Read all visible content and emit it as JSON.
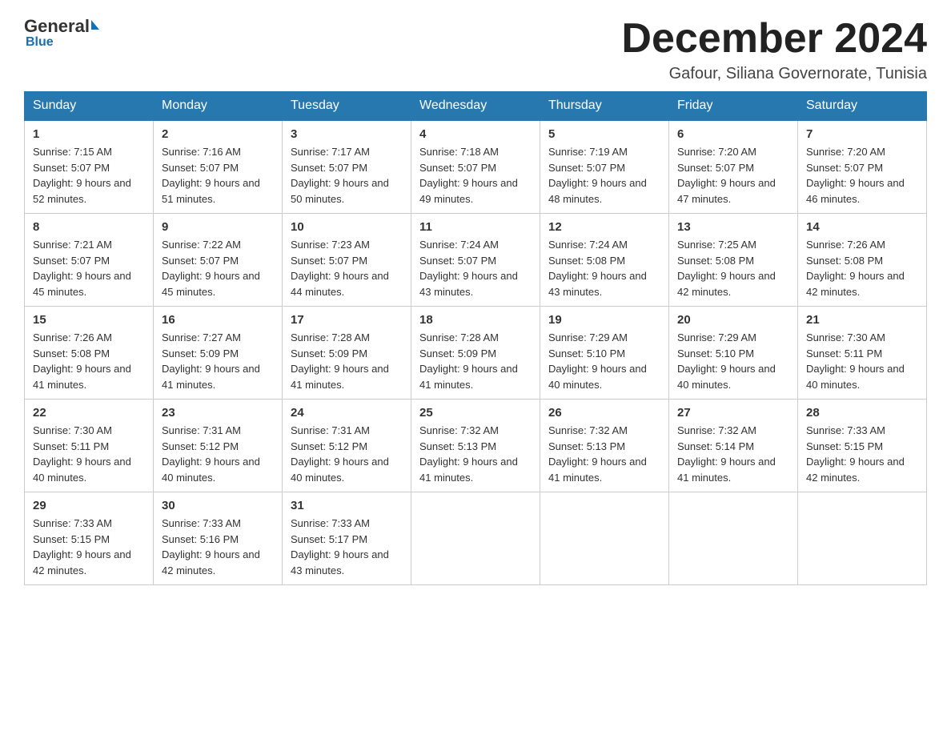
{
  "logo": {
    "general": "General",
    "blue": "Blue",
    "underline": "Blue"
  },
  "header": {
    "month": "December 2024",
    "location": "Gafour, Siliana Governorate, Tunisia"
  },
  "weekdays": [
    "Sunday",
    "Monday",
    "Tuesday",
    "Wednesday",
    "Thursday",
    "Friday",
    "Saturday"
  ],
  "weeks": [
    [
      {
        "day": "1",
        "sunrise": "Sunrise: 7:15 AM",
        "sunset": "Sunset: 5:07 PM",
        "daylight": "Daylight: 9 hours and 52 minutes."
      },
      {
        "day": "2",
        "sunrise": "Sunrise: 7:16 AM",
        "sunset": "Sunset: 5:07 PM",
        "daylight": "Daylight: 9 hours and 51 minutes."
      },
      {
        "day": "3",
        "sunrise": "Sunrise: 7:17 AM",
        "sunset": "Sunset: 5:07 PM",
        "daylight": "Daylight: 9 hours and 50 minutes."
      },
      {
        "day": "4",
        "sunrise": "Sunrise: 7:18 AM",
        "sunset": "Sunset: 5:07 PM",
        "daylight": "Daylight: 9 hours and 49 minutes."
      },
      {
        "day": "5",
        "sunrise": "Sunrise: 7:19 AM",
        "sunset": "Sunset: 5:07 PM",
        "daylight": "Daylight: 9 hours and 48 minutes."
      },
      {
        "day": "6",
        "sunrise": "Sunrise: 7:20 AM",
        "sunset": "Sunset: 5:07 PM",
        "daylight": "Daylight: 9 hours and 47 minutes."
      },
      {
        "day": "7",
        "sunrise": "Sunrise: 7:20 AM",
        "sunset": "Sunset: 5:07 PM",
        "daylight": "Daylight: 9 hours and 46 minutes."
      }
    ],
    [
      {
        "day": "8",
        "sunrise": "Sunrise: 7:21 AM",
        "sunset": "Sunset: 5:07 PM",
        "daylight": "Daylight: 9 hours and 45 minutes."
      },
      {
        "day": "9",
        "sunrise": "Sunrise: 7:22 AM",
        "sunset": "Sunset: 5:07 PM",
        "daylight": "Daylight: 9 hours and 45 minutes."
      },
      {
        "day": "10",
        "sunrise": "Sunrise: 7:23 AM",
        "sunset": "Sunset: 5:07 PM",
        "daylight": "Daylight: 9 hours and 44 minutes."
      },
      {
        "day": "11",
        "sunrise": "Sunrise: 7:24 AM",
        "sunset": "Sunset: 5:07 PM",
        "daylight": "Daylight: 9 hours and 43 minutes."
      },
      {
        "day": "12",
        "sunrise": "Sunrise: 7:24 AM",
        "sunset": "Sunset: 5:08 PM",
        "daylight": "Daylight: 9 hours and 43 minutes."
      },
      {
        "day": "13",
        "sunrise": "Sunrise: 7:25 AM",
        "sunset": "Sunset: 5:08 PM",
        "daylight": "Daylight: 9 hours and 42 minutes."
      },
      {
        "day": "14",
        "sunrise": "Sunrise: 7:26 AM",
        "sunset": "Sunset: 5:08 PM",
        "daylight": "Daylight: 9 hours and 42 minutes."
      }
    ],
    [
      {
        "day": "15",
        "sunrise": "Sunrise: 7:26 AM",
        "sunset": "Sunset: 5:08 PM",
        "daylight": "Daylight: 9 hours and 41 minutes."
      },
      {
        "day": "16",
        "sunrise": "Sunrise: 7:27 AM",
        "sunset": "Sunset: 5:09 PM",
        "daylight": "Daylight: 9 hours and 41 minutes."
      },
      {
        "day": "17",
        "sunrise": "Sunrise: 7:28 AM",
        "sunset": "Sunset: 5:09 PM",
        "daylight": "Daylight: 9 hours and 41 minutes."
      },
      {
        "day": "18",
        "sunrise": "Sunrise: 7:28 AM",
        "sunset": "Sunset: 5:09 PM",
        "daylight": "Daylight: 9 hours and 41 minutes."
      },
      {
        "day": "19",
        "sunrise": "Sunrise: 7:29 AM",
        "sunset": "Sunset: 5:10 PM",
        "daylight": "Daylight: 9 hours and 40 minutes."
      },
      {
        "day": "20",
        "sunrise": "Sunrise: 7:29 AM",
        "sunset": "Sunset: 5:10 PM",
        "daylight": "Daylight: 9 hours and 40 minutes."
      },
      {
        "day": "21",
        "sunrise": "Sunrise: 7:30 AM",
        "sunset": "Sunset: 5:11 PM",
        "daylight": "Daylight: 9 hours and 40 minutes."
      }
    ],
    [
      {
        "day": "22",
        "sunrise": "Sunrise: 7:30 AM",
        "sunset": "Sunset: 5:11 PM",
        "daylight": "Daylight: 9 hours and 40 minutes."
      },
      {
        "day": "23",
        "sunrise": "Sunrise: 7:31 AM",
        "sunset": "Sunset: 5:12 PM",
        "daylight": "Daylight: 9 hours and 40 minutes."
      },
      {
        "day": "24",
        "sunrise": "Sunrise: 7:31 AM",
        "sunset": "Sunset: 5:12 PM",
        "daylight": "Daylight: 9 hours and 40 minutes."
      },
      {
        "day": "25",
        "sunrise": "Sunrise: 7:32 AM",
        "sunset": "Sunset: 5:13 PM",
        "daylight": "Daylight: 9 hours and 41 minutes."
      },
      {
        "day": "26",
        "sunrise": "Sunrise: 7:32 AM",
        "sunset": "Sunset: 5:13 PM",
        "daylight": "Daylight: 9 hours and 41 minutes."
      },
      {
        "day": "27",
        "sunrise": "Sunrise: 7:32 AM",
        "sunset": "Sunset: 5:14 PM",
        "daylight": "Daylight: 9 hours and 41 minutes."
      },
      {
        "day": "28",
        "sunrise": "Sunrise: 7:33 AM",
        "sunset": "Sunset: 5:15 PM",
        "daylight": "Daylight: 9 hours and 42 minutes."
      }
    ],
    [
      {
        "day": "29",
        "sunrise": "Sunrise: 7:33 AM",
        "sunset": "Sunset: 5:15 PM",
        "daylight": "Daylight: 9 hours and 42 minutes."
      },
      {
        "day": "30",
        "sunrise": "Sunrise: 7:33 AM",
        "sunset": "Sunset: 5:16 PM",
        "daylight": "Daylight: 9 hours and 42 minutes."
      },
      {
        "day": "31",
        "sunrise": "Sunrise: 7:33 AM",
        "sunset": "Sunset: 5:17 PM",
        "daylight": "Daylight: 9 hours and 43 minutes."
      },
      null,
      null,
      null,
      null
    ]
  ]
}
